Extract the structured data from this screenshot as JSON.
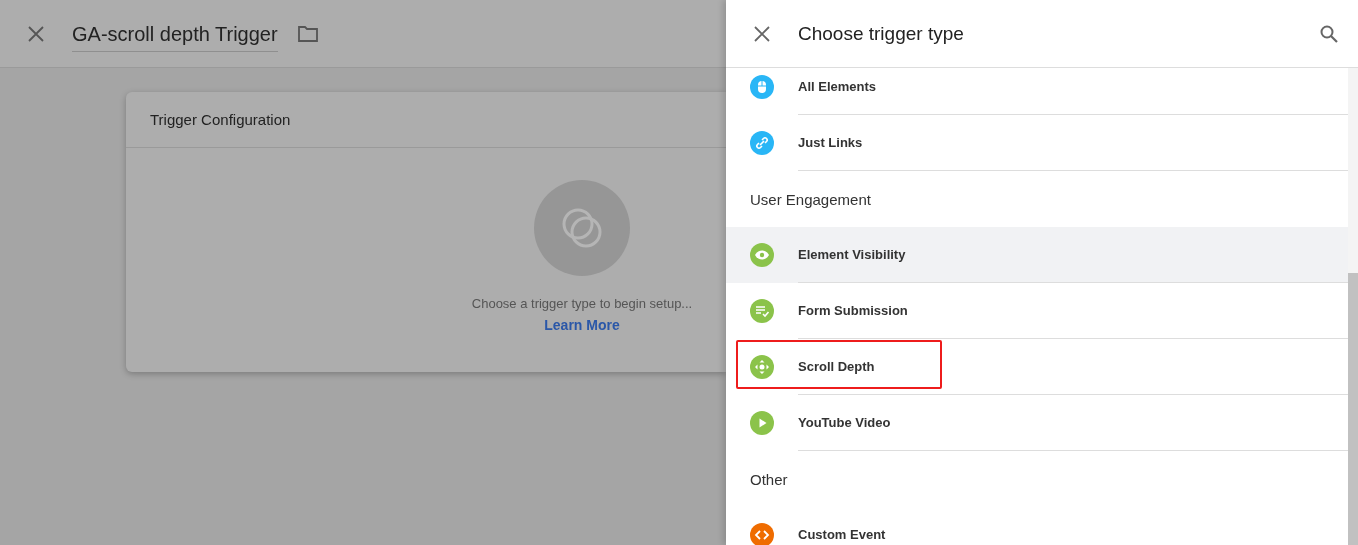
{
  "editor": {
    "title": "GA-scroll depth Trigger",
    "card": {
      "title": "Trigger Configuration",
      "hint": "Choose a trigger type to begin setup...",
      "link": "Learn More"
    }
  },
  "panel": {
    "title": "Choose trigger type",
    "sections": [
      {
        "items": [
          {
            "label": "All Elements",
            "kind": "mouse",
            "color": "#29b6f6",
            "hovered": false,
            "framed": false
          },
          {
            "label": "Just Links",
            "kind": "link",
            "color": "#29b6f6",
            "hovered": false,
            "framed": false
          }
        ]
      },
      {
        "title": "User Engagement",
        "items": [
          {
            "label": "Element Visibility",
            "kind": "eye",
            "color": "#8bc34a",
            "hovered": true,
            "framed": false
          },
          {
            "label": "Form Submission",
            "kind": "form",
            "color": "#8bc34a",
            "hovered": false,
            "framed": false
          },
          {
            "label": "Scroll Depth",
            "kind": "move",
            "color": "#8bc34a",
            "hovered": false,
            "framed": true
          },
          {
            "label": "YouTube Video",
            "kind": "play",
            "color": "#8bc34a",
            "hovered": false,
            "framed": false
          }
        ]
      },
      {
        "title": "Other",
        "items": [
          {
            "label": "Custom Event",
            "kind": "code",
            "color": "#ef6c00",
            "hovered": false,
            "framed": false
          }
        ]
      }
    ]
  }
}
